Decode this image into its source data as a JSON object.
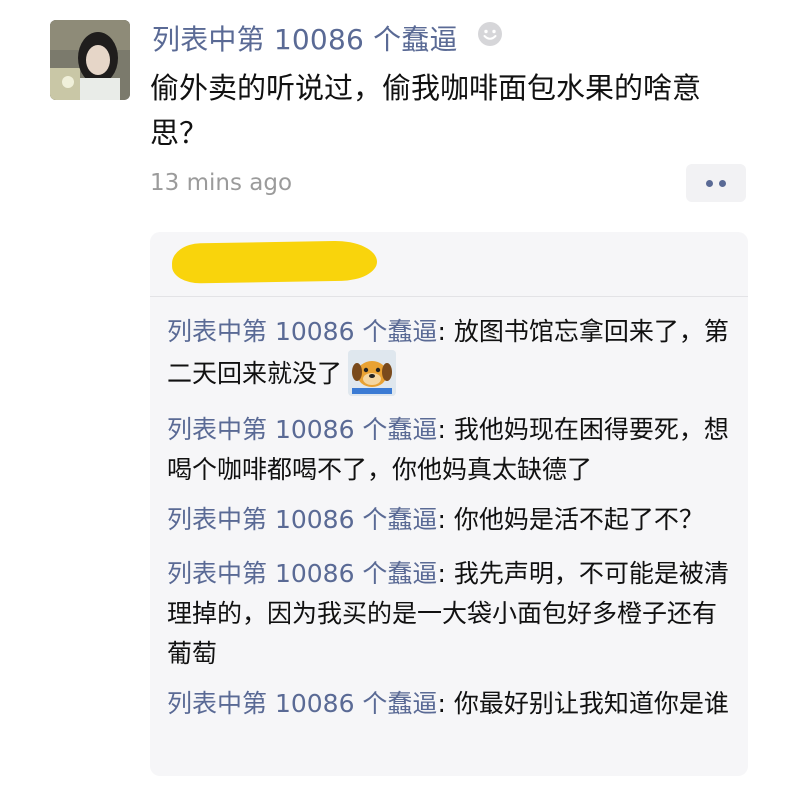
{
  "post": {
    "author": "列表中第 10086 个蠢逼",
    "text": "偷外卖的听说过，偷我咖啡面包水果的啥意思？",
    "timestamp": "13 mins ago"
  },
  "comments": [
    {
      "author": "列表中第 10086 个蠢逼",
      "sep": ": ",
      "text": "放图书馆忘拿回来了，第二天回来就没了"
    },
    {
      "author": "列表中第 10086 个蠢逼",
      "sep": ": ",
      "text": "我他妈现在困得要死，想喝个咖啡都喝不了，你他妈真太缺德了"
    },
    {
      "author": "列表中第 10086 个蠢逼",
      "sep": ": ",
      "text": "你他妈是活不起了不？"
    },
    {
      "author": "列表中第 10086 个蠢逼",
      "sep": ": ",
      "text": "我先声明，不可能是被清理掉的，因为我买的是一大袋小面包好多橙子还有葡萄"
    },
    {
      "author": "列表中第 10086 个蠢逼",
      "sep": ": ",
      "text": "你最好别让我知道你是谁"
    }
  ],
  "icons": {
    "smile": "smile-icon",
    "more": "more-dots-icon",
    "sticker": "dog-sticker-icon"
  },
  "colors": {
    "name": "#5a6a95",
    "timestamp": "#9b9b9b",
    "comment_bg": "#f6f6f8",
    "redaction": "#f9d40c"
  }
}
